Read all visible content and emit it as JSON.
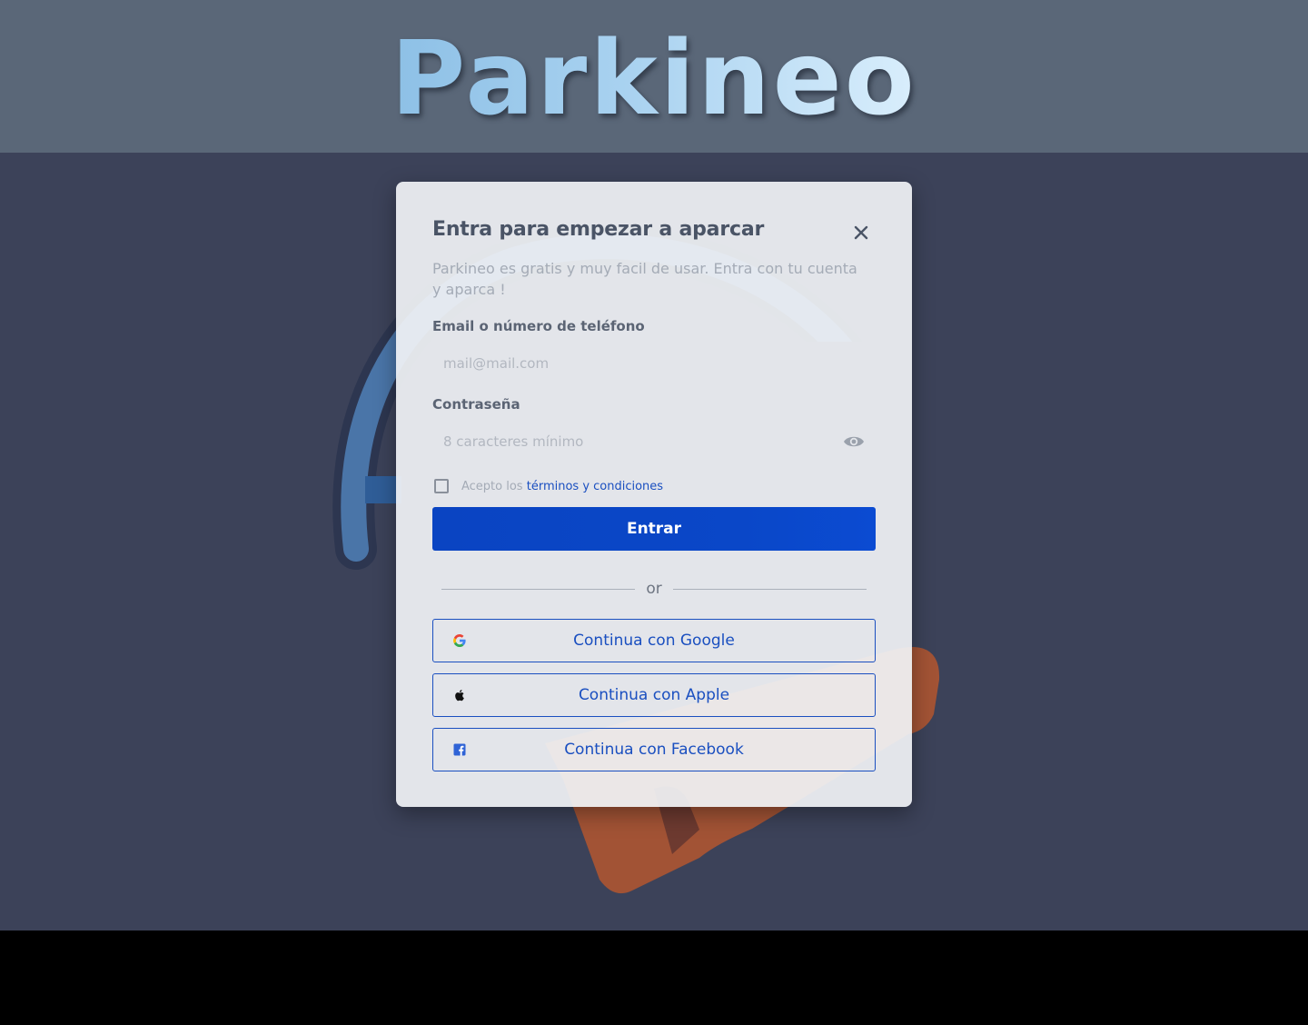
{
  "header": {
    "logo_text": "Parkineo"
  },
  "modal": {
    "title": "Entra para empezar a aparcar",
    "subtitle": "Parkineo es gratis y muy facil de usar. Entra con tu cuenta y aparca !",
    "email": {
      "label": "Email o número de teléfono",
      "placeholder": "mail@mail.com",
      "value": ""
    },
    "password": {
      "label": "Contraseña",
      "placeholder": "8 caracteres mínimo",
      "value": ""
    },
    "terms": {
      "prefix": "Acepto los",
      "link_text": "términos y condiciones",
      "checked": false
    },
    "submit_label": "Entrar",
    "divider_text": "or",
    "social": {
      "google_label": "Continua con Google",
      "apple_label": "Continua con Apple",
      "facebook_label": "Continua con Facebook"
    }
  },
  "colors": {
    "header_bg": "#5a6778",
    "page_bg": "#3c4259",
    "primary": "#0a47c8",
    "link": "#1a4fc0"
  },
  "icons": {
    "close": "close-icon",
    "eye": "eye-icon",
    "google": "google-icon",
    "apple": "apple-icon",
    "facebook": "facebook-icon"
  }
}
